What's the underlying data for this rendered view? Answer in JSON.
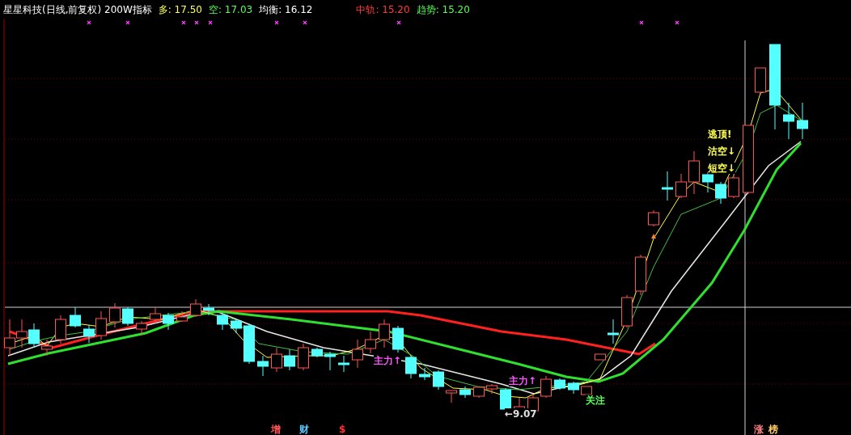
{
  "header": {
    "title": "星星科技(日线,前复权) 200W指标",
    "indicators": [
      {
        "label": "多:",
        "value": "17.50",
        "color": "#ffff54"
      },
      {
        "label": "空:",
        "value": "17.03",
        "color": "#54ff54"
      },
      {
        "label": "均衡:",
        "value": "16.12",
        "color": "#ffffff"
      },
      {
        "label": "中轨:",
        "value": "15.20",
        "color": "#ff3c3c"
      },
      {
        "label": "趋势:",
        "value": "15.20",
        "color": "#54ff54"
      }
    ]
  },
  "chart": {
    "annotations": [
      {
        "text": "逃顶!",
        "color": "#ffff54"
      },
      {
        "text": "沽空↓",
        "color": "#ffff54"
      },
      {
        "text": "短空↓",
        "color": "#ffff54"
      },
      {
        "text": "主力↑",
        "color": "#ff54ff"
      },
      {
        "text": "主力↑",
        "color": "#ff54ff"
      },
      {
        "text": "关注",
        "color": "#54ff54"
      },
      {
        "text": "←9.07",
        "color": "#e0e0e0"
      }
    ]
  },
  "bottom_markers": [
    {
      "text": "增",
      "color": "#ff5454"
    },
    {
      "text": "财",
      "color": "#5cc8ff"
    },
    {
      "text": "$",
      "color": "#ff3030"
    },
    {
      "text": "涨",
      "color": "#ff8080"
    },
    {
      "text": "榜",
      "color": "#ffcc66"
    }
  ]
}
